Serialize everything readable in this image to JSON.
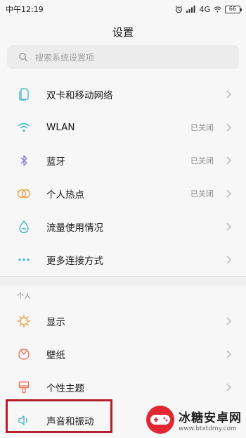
{
  "status_bar": {
    "time": "中午12:19",
    "network": "4G",
    "battery": "66"
  },
  "header": {
    "title": "设置"
  },
  "search": {
    "placeholder": "搜索系统设置项"
  },
  "connection_items": [
    {
      "label": "双卡和移动网络",
      "value": "",
      "icon": "sim-card-icon",
      "color": "#3fb3c6"
    },
    {
      "label": "WLAN",
      "value": "已关闭",
      "icon": "wifi-icon",
      "color": "#3fb3c6"
    },
    {
      "label": "蓝牙",
      "value": "已关闭",
      "icon": "bluetooth-icon",
      "color": "#8a7ad6"
    },
    {
      "label": "个人热点",
      "value": "已关闭",
      "icon": "hotspot-icon",
      "color": "#e8a046"
    },
    {
      "label": "流量使用情况",
      "value": "",
      "icon": "data-usage-icon",
      "color": "#3fb3c6"
    },
    {
      "label": "更多连接方式",
      "value": "",
      "icon": "more-connections-icon",
      "color": "#3fb3c6"
    }
  ],
  "personal_section": {
    "header": "个人",
    "items": [
      {
        "label": "显示",
        "icon": "brightness-icon",
        "color": "#e8a046"
      },
      {
        "label": "壁纸",
        "icon": "wallpaper-icon",
        "color": "#e8705a"
      },
      {
        "label": "个性主题",
        "icon": "theme-icon",
        "color": "#e8705a"
      },
      {
        "label": "声音和振动",
        "icon": "sound-icon",
        "color": "#3fb3c6"
      }
    ]
  },
  "watermark": {
    "title": "冰糖安卓网",
    "url": "www.btxtdmy.com"
  },
  "colors": {
    "highlight": "#b3202a",
    "chevron": "#b5b5b5",
    "accent_teal": "#3fb3c6"
  }
}
